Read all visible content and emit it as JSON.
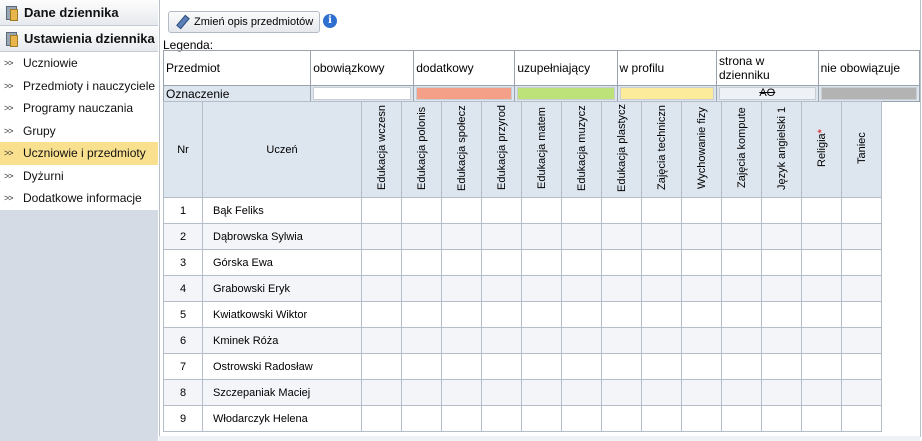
{
  "sidebar": {
    "section1": "Dane dziennika",
    "section2": "Ustawienia dziennika",
    "items": [
      {
        "label": "Uczniowie",
        "active": false
      },
      {
        "label": "Przedmioty i nauczyciele",
        "active": false
      },
      {
        "label": "Programy nauczania",
        "active": false
      },
      {
        "label": "Grupy",
        "active": false
      },
      {
        "label": "Uczniowie i przedmioty",
        "active": true
      },
      {
        "label": "Dyżurni",
        "active": false
      },
      {
        "label": "Dodatkowe informacje",
        "active": false
      }
    ]
  },
  "toolbar": {
    "edit_label": "Zmień opis przedmiotów",
    "info_glyph": "i"
  },
  "legend": {
    "title": "Legenda:",
    "row1_label": "Przedmiot",
    "row2_label": "Oznaczenie",
    "columns": [
      {
        "label": "obowiązkowy",
        "color": "#ffffff",
        "mark": ""
      },
      {
        "label": "dodatkowy",
        "color": "#f4a088",
        "mark": ""
      },
      {
        "label": "uzupełniający",
        "color": "#bde27a",
        "mark": ""
      },
      {
        "label": "w profilu",
        "color": "#fbeb9b",
        "mark": ""
      },
      {
        "label": "strona w dzienniku",
        "color": "#eef1f5",
        "mark": "AO"
      },
      {
        "label": "nie obowiązuje",
        "color": "#b3b3b3",
        "mark": ""
      }
    ]
  },
  "grid": {
    "col_nr": "Nr",
    "col_student": "Uczeń",
    "subjects": [
      {
        "label": "Edukacja wczesn",
        "required": false
      },
      {
        "label": "Edukacja polonis",
        "required": false
      },
      {
        "label": "Edukacja społecz",
        "required": false
      },
      {
        "label": "Edukacja przyrod",
        "required": false
      },
      {
        "label": "Edukacja matem",
        "required": false
      },
      {
        "label": "Edukacja muzycz",
        "required": false
      },
      {
        "label": "Edukacja plastycz",
        "required": false
      },
      {
        "label": "Zajęcia techniczn",
        "required": false
      },
      {
        "label": "Wychowanie fizy",
        "required": false
      },
      {
        "label": "Zajęcia kompute",
        "required": false
      },
      {
        "label": "Język angielski 1",
        "required": false
      },
      {
        "label": "Religia",
        "required": true
      },
      {
        "label": "Taniec",
        "required": false
      }
    ],
    "required_mark": "*",
    "students": [
      {
        "nr": "1",
        "name": "Bąk Feliks"
      },
      {
        "nr": "2",
        "name": "Dąbrowska Sylwia"
      },
      {
        "nr": "3",
        "name": "Górska Ewa"
      },
      {
        "nr": "4",
        "name": "Grabowski Eryk"
      },
      {
        "nr": "5",
        "name": "Kwiatkowski Wiktor"
      },
      {
        "nr": "6",
        "name": "Kminek Róża"
      },
      {
        "nr": "7",
        "name": "Ostrowski Radosław"
      },
      {
        "nr": "8",
        "name": "Szczepaniak Maciej"
      },
      {
        "nr": "9",
        "name": "Włodarczyk Helena"
      }
    ]
  }
}
